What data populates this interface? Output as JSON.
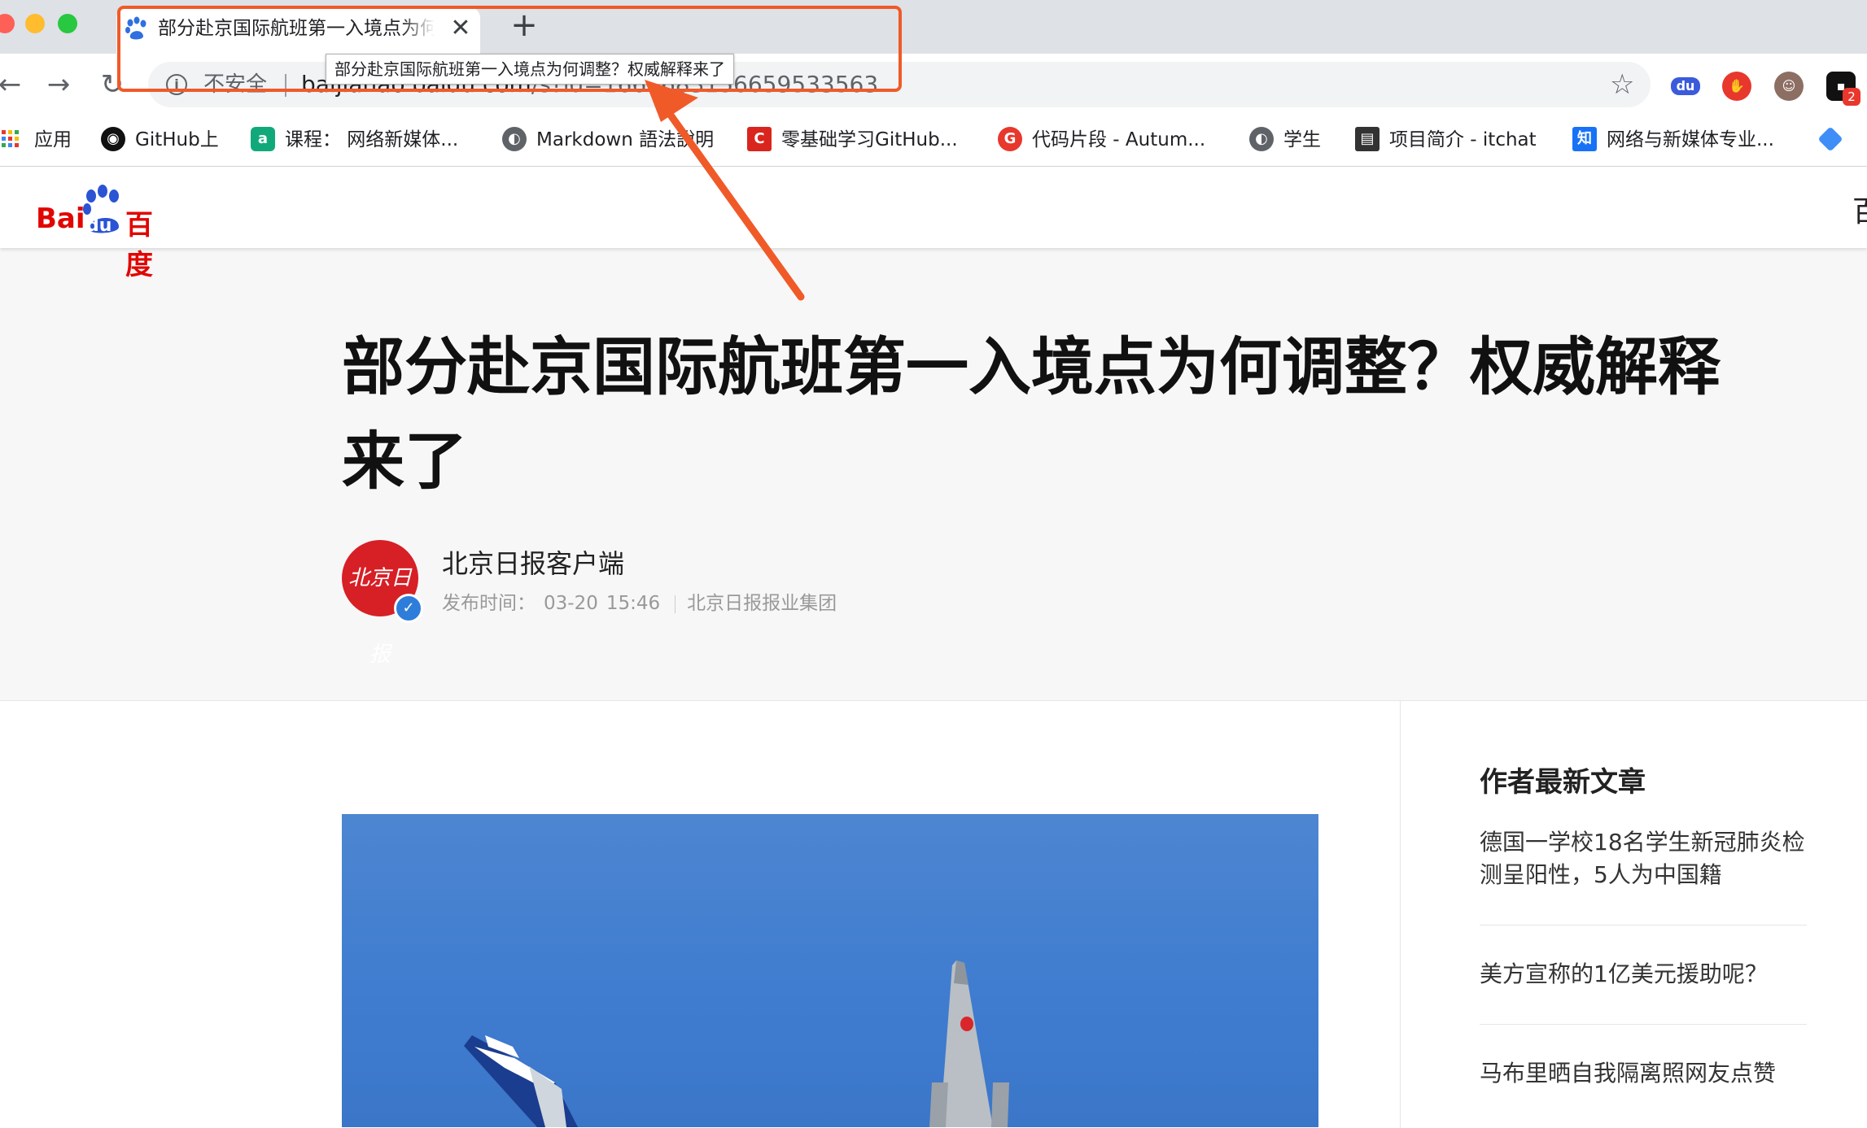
{
  "browser": {
    "tab": {
      "title": "部分赴京国际航班第一入境点为何调整？权威解释来了",
      "favicon": "baidu-paw-icon"
    },
    "address_bar": {
      "security_label": "不安全",
      "url_host": "baijiahao.baidu.com",
      "url_path": "/s?id=1661683156659533563"
    },
    "tooltip": "部分赴京国际航班第一入境点为何调整？权威解释来了",
    "extensions": [
      {
        "name": "du-extension-icon",
        "label": "du",
        "color": "#3b5bdb"
      },
      {
        "name": "adblock-icon",
        "label": "",
        "color": "#e8372c"
      },
      {
        "name": "avatar-extension-icon",
        "label": "",
        "color": "#6d4c41"
      },
      {
        "name": "pocket-extension-icon",
        "label": "",
        "color": "#111111"
      }
    ],
    "extension_badge": "2",
    "bookmarks": [
      {
        "label": "应用",
        "icon": "apps-grid-icon",
        "color": "#e8372c"
      },
      {
        "label": "GitHub上",
        "icon": "github-icon",
        "color": "#111111"
      },
      {
        "label": "课程： 网络新媒体...",
        "icon": "course-icon",
        "color": "#12a97a"
      },
      {
        "label": "Markdown 語法說明",
        "icon": "globe-icon",
        "color": "#5f6368"
      },
      {
        "label": "零基础学习GitHub...",
        "icon": "csdn-icon",
        "color": "#d9251d"
      },
      {
        "label": "代码片段 - Autum...",
        "icon": "gitee-icon",
        "color": "#e8372c"
      },
      {
        "label": "学生",
        "icon": "globe-icon",
        "color": "#5f6368"
      },
      {
        "label": "项目简介 - itchat",
        "icon": "book-icon",
        "color": "#333333"
      },
      {
        "label": "网络与新媒体专业...",
        "icon": "zhihu-icon",
        "color": "#1772f6"
      }
    ]
  },
  "site": {
    "logo_text_latin": "Bai",
    "logo_text_du": "du",
    "logo_text_cn": "百度",
    "header_cut_text": "百"
  },
  "article": {
    "title_line1": "部分赴京国际航班第一入境点为何调整？权威解释",
    "title_line2": "来了",
    "author": "北京日报客户端",
    "avatar_text": "北京日报",
    "publish_label": "发布时间：",
    "publish_date": "03-20",
    "publish_time": "15:46",
    "publisher": "北京日报报业集团"
  },
  "sidebar": {
    "title": "作者最新文章",
    "items": [
      "德国一学校18名学生新冠肺炎检测呈阳性，5人为中国籍",
      "美方宣称的1亿美元援助呢？",
      "马布里晒自我隔离照网友点赞"
    ]
  },
  "annotation": {
    "color": "#f05a28"
  }
}
